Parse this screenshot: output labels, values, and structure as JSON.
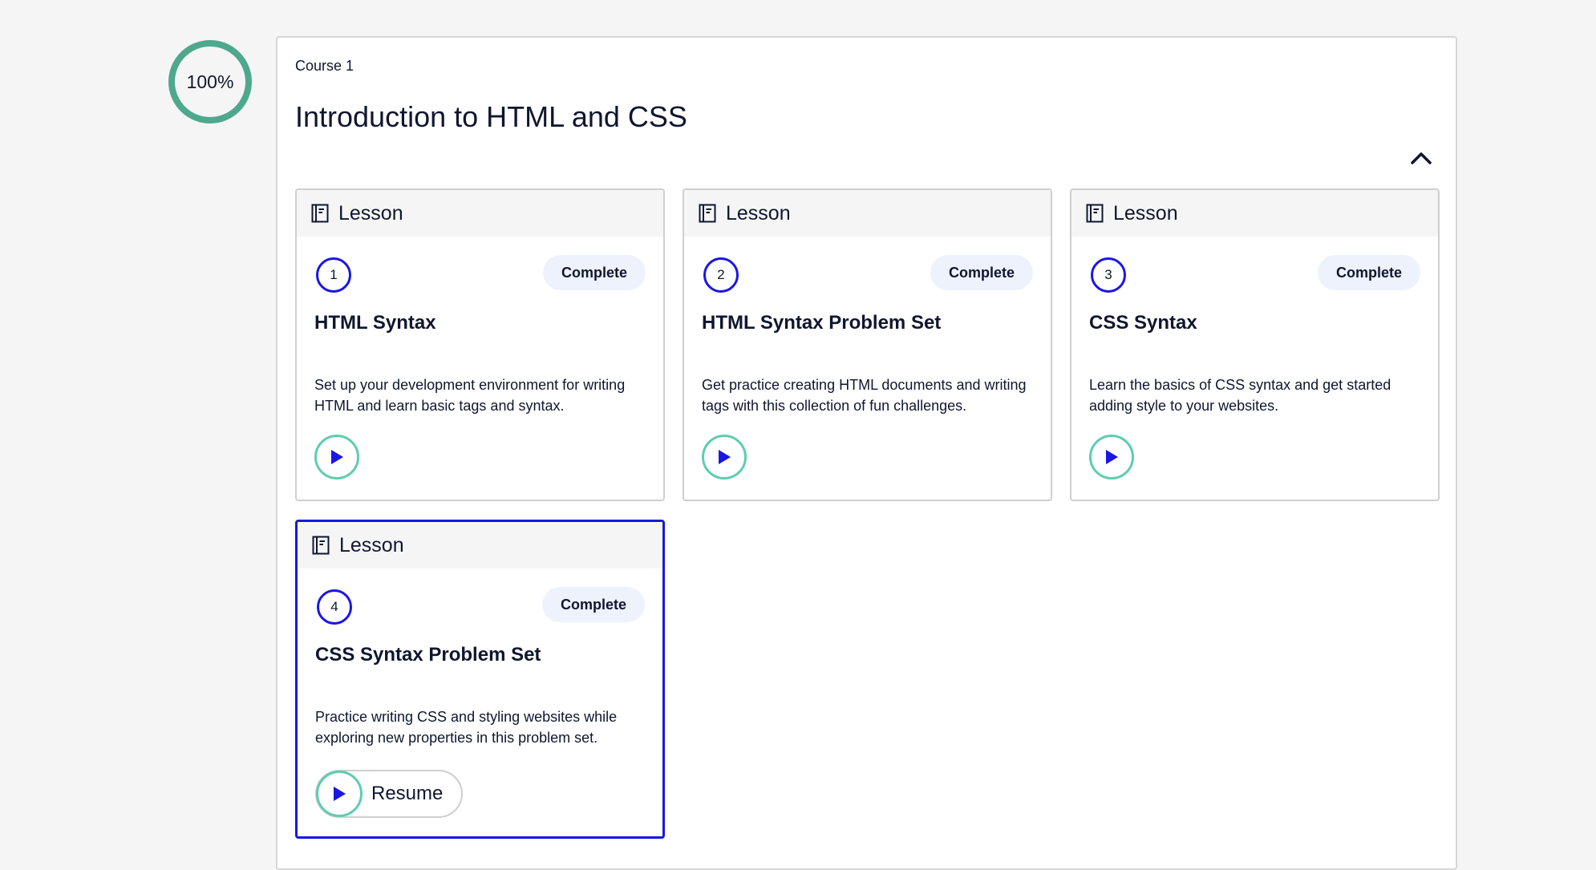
{
  "progress": {
    "percent_label": "100%",
    "value": 1.0,
    "ring_color": "#4ea88c"
  },
  "course": {
    "label": "Course 1",
    "title": "Introduction to HTML and CSS",
    "collapse_icon": "chevron-up-icon"
  },
  "lessons": [
    {
      "type": "Lesson",
      "number": "1",
      "status": "Complete",
      "title": "HTML Syntax",
      "description": "Set up your development environment for writing HTML and learn basic tags and syntax."
    },
    {
      "type": "Lesson",
      "number": "2",
      "status": "Complete",
      "title": "HTML Syntax Problem Set",
      "description": "Get practice creating HTML documents and writing tags with this collection of fun challenges."
    },
    {
      "type": "Lesson",
      "number": "3",
      "status": "Complete",
      "title": "CSS Syntax",
      "description": "Learn the basics of CSS syntax and get started adding style to your websites."
    },
    {
      "type": "Lesson",
      "number": "4",
      "status": "Complete",
      "title": "CSS Syntax Problem Set",
      "description": "Practice writing CSS and styling websites while exploring new properties in this problem set.",
      "resume_label": "Resume"
    }
  ],
  "colors": {
    "accent": "#1a16e6",
    "play_ring": "#5ecdb0",
    "pill_bg": "#eef2fd"
  },
  "icons": {
    "lesson": "notebook-icon",
    "play": "play-icon"
  }
}
